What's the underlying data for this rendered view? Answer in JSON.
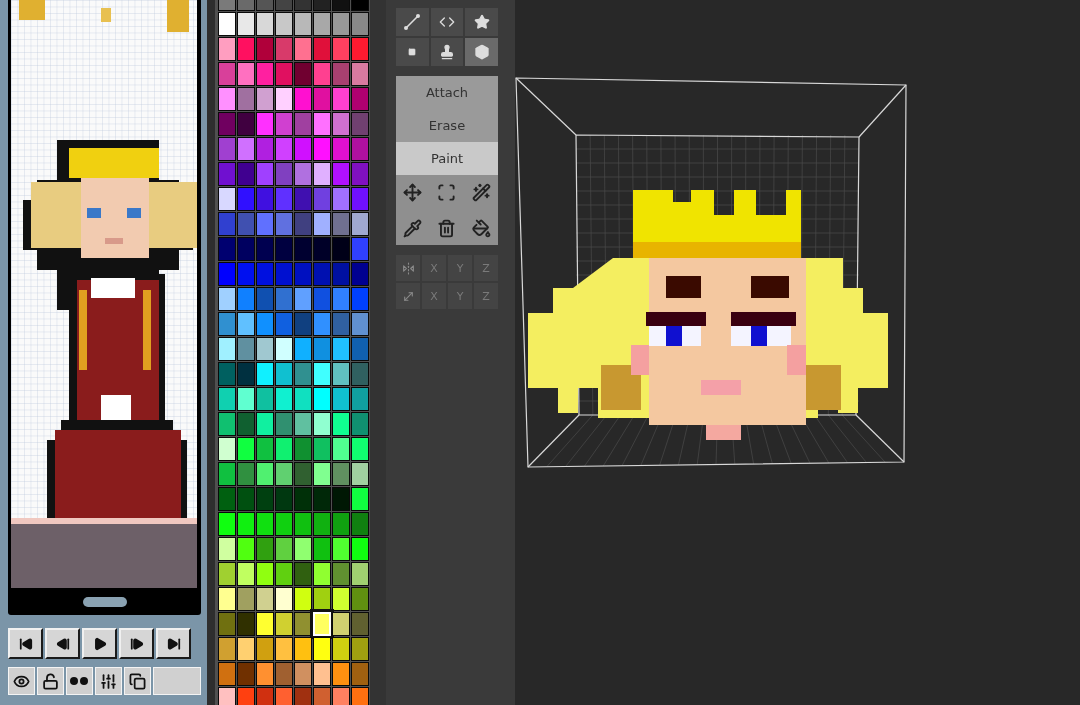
{
  "timeline": {
    "playback_buttons": [
      {
        "kind": "first"
      },
      {
        "kind": "prev"
      },
      {
        "kind": "play"
      },
      {
        "kind": "next"
      },
      {
        "kind": "last"
      }
    ],
    "layer_buttons": [
      {
        "kind": "visibility"
      },
      {
        "kind": "lock"
      },
      {
        "kind": "onion"
      },
      {
        "kind": "adjust"
      },
      {
        "kind": "duplicate"
      },
      {
        "kind": "blank"
      }
    ]
  },
  "palette": {
    "rows": [
      [
        {
          "color": "#7a7a7a",
          "selected": false
        },
        {
          "color": "#6a6a6a",
          "selected": false
        },
        {
          "color": "#555555",
          "selected": false
        },
        {
          "color": "#444444",
          "selected": false
        },
        {
          "color": "#333333",
          "selected": false
        },
        {
          "color": "#222222",
          "selected": false
        },
        {
          "color": "#111111",
          "selected": false
        },
        {
          "color": "#000000",
          "selected": false
        }
      ],
      [
        {
          "color": "#ffffff",
          "selected": false
        },
        {
          "color": "#e8e8e8",
          "selected": false
        },
        {
          "color": "#d8d8d8",
          "selected": false
        },
        {
          "color": "#c8c8c8",
          "selected": false
        },
        {
          "color": "#b8b8b8",
          "selected": false
        },
        {
          "color": "#a8a8a8",
          "selected": false
        },
        {
          "color": "#989898",
          "selected": false
        },
        {
          "color": "#888888",
          "selected": false
        }
      ],
      [
        {
          "color": "#ff9ec0",
          "selected": false
        },
        {
          "color": "#ff1060",
          "selected": false
        },
        {
          "color": "#b0003a",
          "selected": false
        },
        {
          "color": "#d83a6a",
          "selected": false
        },
        {
          "color": "#ff7090",
          "selected": false
        },
        {
          "color": "#e0103a",
          "selected": false
        },
        {
          "color": "#ff4060",
          "selected": false
        },
        {
          "color": "#ff1a30",
          "selected": false
        }
      ],
      [
        {
          "color": "#d8409a",
          "selected": false
        },
        {
          "color": "#ff70c0",
          "selected": false
        },
        {
          "color": "#ff20a0",
          "selected": false
        },
        {
          "color": "#e01060",
          "selected": false
        },
        {
          "color": "#700030",
          "selected": false
        },
        {
          "color": "#ff4090",
          "selected": false
        },
        {
          "color": "#a84070",
          "selected": false
        },
        {
          "color": "#d87aa0",
          "selected": false
        }
      ],
      [
        {
          "color": "#ff90ff",
          "selected": false
        },
        {
          "color": "#a070a0",
          "selected": false
        },
        {
          "color": "#d0a0d0",
          "selected": false
        },
        {
          "color": "#ffd0ff",
          "selected": false
        },
        {
          "color": "#ff10d0",
          "selected": false
        },
        {
          "color": "#e010a0",
          "selected": false
        },
        {
          "color": "#ff40d0",
          "selected": false
        },
        {
          "color": "#b00070",
          "selected": false
        }
      ],
      [
        {
          "color": "#700060",
          "selected": false
        },
        {
          "color": "#400040",
          "selected": false
        },
        {
          "color": "#ff30ff",
          "selected": false
        },
        {
          "color": "#d040d0",
          "selected": false
        },
        {
          "color": "#a040a0",
          "selected": false
        },
        {
          "color": "#ff70ff",
          "selected": false
        },
        {
          "color": "#d070d0",
          "selected": false
        },
        {
          "color": "#704070",
          "selected": false
        }
      ],
      [
        {
          "color": "#a040d0",
          "selected": false
        },
        {
          "color": "#d070ff",
          "selected": false
        },
        {
          "color": "#b020e0",
          "selected": false
        },
        {
          "color": "#d040ff",
          "selected": false
        },
        {
          "color": "#d010ff",
          "selected": false
        },
        {
          "color": "#ff10ff",
          "selected": false
        },
        {
          "color": "#e010d0",
          "selected": false
        },
        {
          "color": "#b010a0",
          "selected": false
        }
      ],
      [
        {
          "color": "#7010d0",
          "selected": false
        },
        {
          "color": "#400090",
          "selected": false
        },
        {
          "color": "#a040ff",
          "selected": false
        },
        {
          "color": "#8040c0",
          "selected": false
        },
        {
          "color": "#b070e0",
          "selected": false
        },
        {
          "color": "#e0b0ff",
          "selected": false
        },
        {
          "color": "#b010ff",
          "selected": false
        },
        {
          "color": "#8010c0",
          "selected": false
        }
      ],
      [
        {
          "color": "#d8d8ff",
          "selected": false
        },
        {
          "color": "#3010ff",
          "selected": false
        },
        {
          "color": "#4010e0",
          "selected": false
        },
        {
          "color": "#6030ff",
          "selected": false
        },
        {
          "color": "#4010b0",
          "selected": false
        },
        {
          "color": "#7040e0",
          "selected": false
        },
        {
          "color": "#a070ff",
          "selected": false
        },
        {
          "color": "#7010ff",
          "selected": false
        }
      ],
      [
        {
          "color": "#3040d0",
          "selected": false
        },
        {
          "color": "#4050b0",
          "selected": false
        },
        {
          "color": "#6070ff",
          "selected": false
        },
        {
          "color": "#6070e0",
          "selected": false
        },
        {
          "color": "#404080",
          "selected": false
        },
        {
          "color": "#a0b0ff",
          "selected": false
        },
        {
          "color": "#707090",
          "selected": false
        },
        {
          "color": "#a0a8d0",
          "selected": false
        }
      ],
      [
        {
          "color": "#000070",
          "selected": false
        },
        {
          "color": "#000060",
          "selected": false
        },
        {
          "color": "#000050",
          "selected": false
        },
        {
          "color": "#000040",
          "selected": false
        },
        {
          "color": "#000030",
          "selected": false
        },
        {
          "color": "#000028",
          "selected": false
        },
        {
          "color": "#000018",
          "selected": false
        },
        {
          "color": "#3040ff",
          "selected": false
        }
      ],
      [
        {
          "color": "#0000ff",
          "selected": false
        },
        {
          "color": "#0010f0",
          "selected": false
        },
        {
          "color": "#0010e0",
          "selected": false
        },
        {
          "color": "#0010d0",
          "selected": false
        },
        {
          "color": "#0010c0",
          "selected": false
        },
        {
          "color": "#0010b0",
          "selected": false
        },
        {
          "color": "#0010a0",
          "selected": false
        },
        {
          "color": "#000090",
          "selected": false
        }
      ],
      [
        {
          "color": "#a0d0ff",
          "selected": false
        },
        {
          "color": "#1080ff",
          "selected": false
        },
        {
          "color": "#1050b0",
          "selected": false
        },
        {
          "color": "#3070d0",
          "selected": false
        },
        {
          "color": "#60a0ff",
          "selected": false
        },
        {
          "color": "#1050e0",
          "selected": false
        },
        {
          "color": "#3080ff",
          "selected": false
        },
        {
          "color": "#0040ff",
          "selected": false
        }
      ],
      [
        {
          "color": "#3090d0",
          "selected": false
        },
        {
          "color": "#60c0ff",
          "selected": false
        },
        {
          "color": "#1090ff",
          "selected": false
        },
        {
          "color": "#1060e0",
          "selected": false
        },
        {
          "color": "#104080",
          "selected": false
        },
        {
          "color": "#3090ff",
          "selected": false
        },
        {
          "color": "#3060a0",
          "selected": false
        },
        {
          "color": "#6090d0",
          "selected": false
        }
      ],
      [
        {
          "color": "#a0f0ff",
          "selected": false
        },
        {
          "color": "#6090a0",
          "selected": false
        },
        {
          "color": "#a0c8d0",
          "selected": false
        },
        {
          "color": "#d0ffff",
          "selected": false
        },
        {
          "color": "#10b0ff",
          "selected": false
        },
        {
          "color": "#1090e0",
          "selected": false
        },
        {
          "color": "#20c0ff",
          "selected": false
        },
        {
          "color": "#1060b0",
          "selected": false
        }
      ],
      [
        {
          "color": "#006060",
          "selected": false
        },
        {
          "color": "#003040",
          "selected": false
        },
        {
          "color": "#10f0ff",
          "selected": false
        },
        {
          "color": "#10c0d0",
          "selected": false
        },
        {
          "color": "#309090",
          "selected": false
        },
        {
          "color": "#40ffff",
          "selected": false
        },
        {
          "color": "#60c0c0",
          "selected": false
        },
        {
          "color": "#306060",
          "selected": false
        }
      ],
      [
        {
          "color": "#10d0b0",
          "selected": false
        },
        {
          "color": "#60ffd0",
          "selected": false
        },
        {
          "color": "#10c0a0",
          "selected": false
        },
        {
          "color": "#10f0d0",
          "selected": false
        },
        {
          "color": "#10e0c0",
          "selected": false
        },
        {
          "color": "#00ffff",
          "selected": false
        },
        {
          "color": "#10c0d0",
          "selected": false
        },
        {
          "color": "#10a0a0",
          "selected": false
        }
      ],
      [
        {
          "color": "#10c070",
          "selected": false
        },
        {
          "color": "#106030",
          "selected": false
        },
        {
          "color": "#10f0a0",
          "selected": false
        },
        {
          "color": "#309070",
          "selected": false
        },
        {
          "color": "#60c0a0",
          "selected": false
        },
        {
          "color": "#90ffd0",
          "selected": false
        },
        {
          "color": "#10ff90",
          "selected": false
        },
        {
          "color": "#109070",
          "selected": false
        }
      ],
      [
        {
          "color": "#d0ffd0",
          "selected": false
        },
        {
          "color": "#10ff40",
          "selected": false
        },
        {
          "color": "#10c040",
          "selected": false
        },
        {
          "color": "#10f070",
          "selected": false
        },
        {
          "color": "#109030",
          "selected": false
        },
        {
          "color": "#10c060",
          "selected": false
        },
        {
          "color": "#50ff90",
          "selected": false
        },
        {
          "color": "#10ff70",
          "selected": false
        }
      ],
      [
        {
          "color": "#10c040",
          "selected": false
        },
        {
          "color": "#309040",
          "selected": false
        },
        {
          "color": "#50f070",
          "selected": false
        },
        {
          "color": "#60d070",
          "selected": false
        },
        {
          "color": "#306030",
          "selected": false
        },
        {
          "color": "#80ff90",
          "selected": false
        },
        {
          "color": "#609060",
          "selected": false
        },
        {
          "color": "#a0d0a0",
          "selected": false
        }
      ],
      [
        {
          "color": "#006010",
          "selected": false
        },
        {
          "color": "#005010",
          "selected": false
        },
        {
          "color": "#004010",
          "selected": false
        },
        {
          "color": "#003810",
          "selected": false
        },
        {
          "color": "#003008",
          "selected": false
        },
        {
          "color": "#002808",
          "selected": false
        },
        {
          "color": "#001804",
          "selected": false
        },
        {
          "color": "#10ff40",
          "selected": false
        }
      ],
      [
        {
          "color": "#10ff10",
          "selected": false
        },
        {
          "color": "#10f010",
          "selected": false
        },
        {
          "color": "#10e010",
          "selected": false
        },
        {
          "color": "#10d010",
          "selected": false
        },
        {
          "color": "#10c010",
          "selected": false
        },
        {
          "color": "#10b010",
          "selected": false
        },
        {
          "color": "#10a010",
          "selected": false
        },
        {
          "color": "#108010",
          "selected": false
        }
      ],
      [
        {
          "color": "#d0ffa0",
          "selected": false
        },
        {
          "color": "#50ff10",
          "selected": false
        },
        {
          "color": "#30a010",
          "selected": false
        },
        {
          "color": "#60d040",
          "selected": false
        },
        {
          "color": "#90ff70",
          "selected": false
        },
        {
          "color": "#10c010",
          "selected": false
        },
        {
          "color": "#50ff30",
          "selected": false
        },
        {
          "color": "#10ff10",
          "selected": false
        }
      ],
      [
        {
          "color": "#a0d030",
          "selected": false
        },
        {
          "color": "#c0ff60",
          "selected": false
        },
        {
          "color": "#90ff10",
          "selected": false
        },
        {
          "color": "#60d010",
          "selected": false
        },
        {
          "color": "#306010",
          "selected": false
        },
        {
          "color": "#90ff30",
          "selected": false
        },
        {
          "color": "#609030",
          "selected": false
        },
        {
          "color": "#a0d070",
          "selected": false
        }
      ],
      [
        {
          "color": "#ffff90",
          "selected": false
        },
        {
          "color": "#a0a060",
          "selected": false
        },
        {
          "color": "#d0d090",
          "selected": false
        },
        {
          "color": "#ffffd0",
          "selected": false
        },
        {
          "color": "#d0ff10",
          "selected": false
        },
        {
          "color": "#a0d010",
          "selected": false
        },
        {
          "color": "#d0ff30",
          "selected": false
        },
        {
          "color": "#609010",
          "selected": false
        }
      ],
      [
        {
          "color": "#707010",
          "selected": false
        },
        {
          "color": "#303000",
          "selected": false
        },
        {
          "color": "#ffff30",
          "selected": false
        },
        {
          "color": "#d0d030",
          "selected": false
        },
        {
          "color": "#909030",
          "selected": false
        },
        {
          "color": "#ffff60",
          "selected": true
        },
        {
          "color": "#d0d070",
          "selected": false
        },
        {
          "color": "#606030",
          "selected": false
        }
      ],
      [
        {
          "color": "#d0a030",
          "selected": false
        },
        {
          "color": "#ffd070",
          "selected": false
        },
        {
          "color": "#d0a010",
          "selected": false
        },
        {
          "color": "#ffc040",
          "selected": false
        },
        {
          "color": "#ffc010",
          "selected": false
        },
        {
          "color": "#ffff10",
          "selected": false
        },
        {
          "color": "#d0d010",
          "selected": false
        },
        {
          "color": "#a0a010",
          "selected": false
        }
      ],
      [
        {
          "color": "#d07010",
          "selected": false
        },
        {
          "color": "#703000",
          "selected": false
        },
        {
          "color": "#ff9030",
          "selected": false
        },
        {
          "color": "#a06030",
          "selected": false
        },
        {
          "color": "#d09060",
          "selected": false
        },
        {
          "color": "#ffc090",
          "selected": false
        },
        {
          "color": "#ff9010",
          "selected": false
        },
        {
          "color": "#a06010",
          "selected": false
        }
      ],
      [
        {
          "color": "#ffc0c0",
          "selected": false
        },
        {
          "color": "#ff4010",
          "selected": false
        },
        {
          "color": "#d03010",
          "selected": false
        },
        {
          "color": "#ff6030",
          "selected": false
        },
        {
          "color": "#a03010",
          "selected": false
        },
        {
          "color": "#d06030",
          "selected": false
        },
        {
          "color": "#ff8060",
          "selected": false
        },
        {
          "color": "#ff7010",
          "selected": false
        }
      ]
    ]
  },
  "shape_tools": [
    {
      "kind": "line",
      "selected": false
    },
    {
      "kind": "code",
      "selected": false
    },
    {
      "kind": "star",
      "selected": false
    },
    {
      "kind": "dot",
      "selected": false
    },
    {
      "kind": "stamp",
      "selected": false
    },
    {
      "kind": "cube",
      "selected": true
    }
  ],
  "modes": [
    {
      "label": "Attach",
      "selected": false
    },
    {
      "label": "Erase",
      "selected": false
    },
    {
      "label": "Paint",
      "selected": true
    }
  ],
  "edit_tools": [
    {
      "kind": "move"
    },
    {
      "kind": "select"
    },
    {
      "kind": "wand"
    },
    {
      "kind": "picker"
    },
    {
      "kind": "delete"
    },
    {
      "kind": "fill"
    }
  ],
  "axis_rows": [
    {
      "kind": "mirror",
      "axes": [
        "X",
        "Y",
        "Z"
      ]
    },
    {
      "kind": "scale",
      "axes": [
        "X",
        "Y",
        "Z"
      ]
    }
  ]
}
